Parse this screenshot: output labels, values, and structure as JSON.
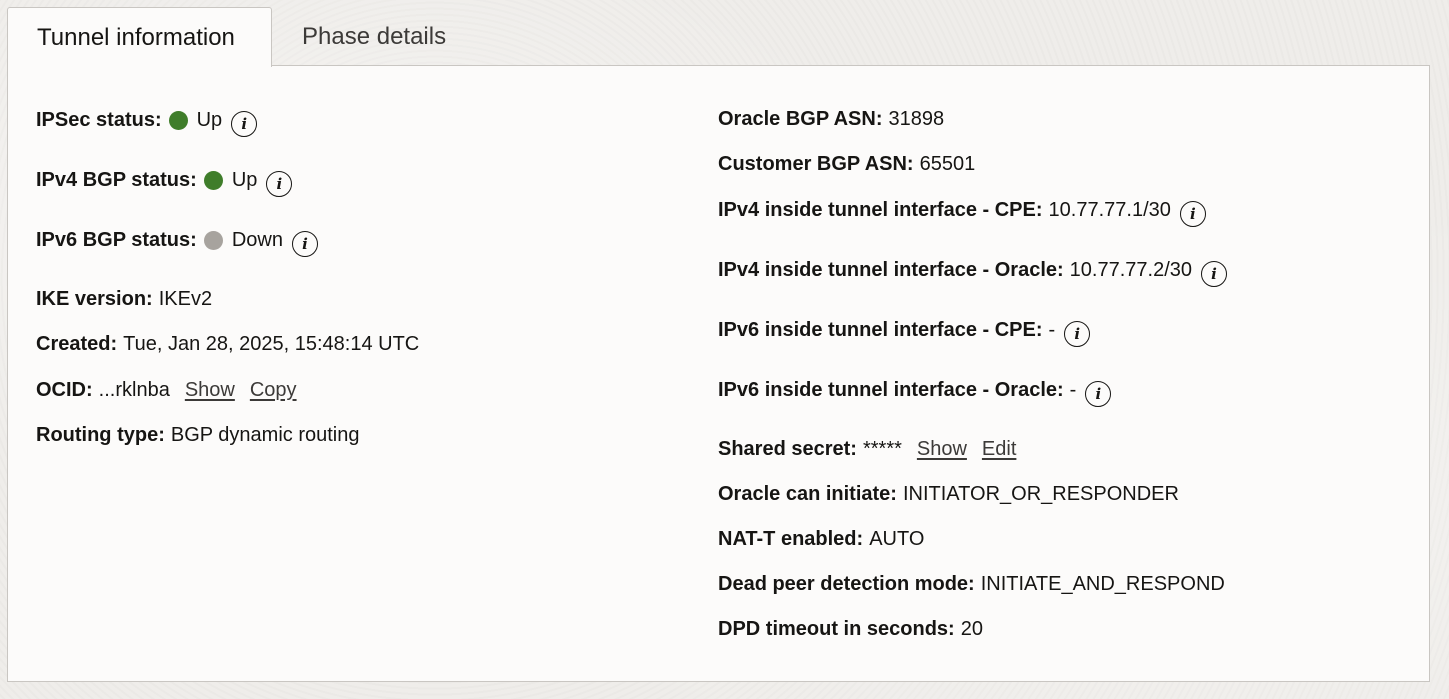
{
  "tabs": {
    "tunnel_information": "Tunnel information",
    "phase_details": "Phase details"
  },
  "colors": {
    "status_up": "#3f7d2a",
    "status_down": "#a7a39e"
  },
  "icons": {
    "info": "i"
  },
  "left": {
    "ipsec_status": {
      "label": "IPSec status:",
      "value": "Up",
      "status": "up",
      "icon": "info-icon"
    },
    "ipv4_bgp_status": {
      "label": "IPv4 BGP status:",
      "value": "Up",
      "status": "up",
      "icon": "info-icon"
    },
    "ipv6_bgp_status": {
      "label": "IPv6 BGP status:",
      "value": "Down",
      "status": "down",
      "icon": "info-icon"
    },
    "ike_version": {
      "label": "IKE version:",
      "value": "IKEv2"
    },
    "created": {
      "label": "Created:",
      "value": "Tue, Jan 28, 2025, 15:48:14 UTC"
    },
    "ocid": {
      "label": "OCID:",
      "value": "...rklnba",
      "show": "Show",
      "copy": "Copy"
    },
    "routing_type": {
      "label": "Routing type:",
      "value": "BGP dynamic routing"
    }
  },
  "right": {
    "oracle_bgp_asn": {
      "label": "Oracle BGP ASN:",
      "value": "31898"
    },
    "customer_bgp_asn": {
      "label": "Customer BGP ASN:",
      "value": "65501"
    },
    "ipv4_cpe": {
      "label": "IPv4 inside tunnel interface - CPE:",
      "value": "10.77.77.1/30",
      "icon": "info-icon"
    },
    "ipv4_oracle": {
      "label": "IPv4 inside tunnel interface - Oracle:",
      "value": "10.77.77.2/30",
      "icon": "info-icon"
    },
    "ipv6_cpe": {
      "label": "IPv6 inside tunnel interface - CPE:",
      "value": "-",
      "icon": "info-icon"
    },
    "ipv6_oracle": {
      "label": "IPv6 inside tunnel interface - Oracle:",
      "value": "-",
      "icon": "info-icon"
    },
    "shared_secret": {
      "label": "Shared secret:",
      "value": "*****",
      "show": "Show",
      "edit": "Edit"
    },
    "oracle_can_initiate": {
      "label": "Oracle can initiate:",
      "value": "INITIATOR_OR_RESPONDER"
    },
    "nat_t_enabled": {
      "label": "NAT-T enabled:",
      "value": "AUTO"
    },
    "dpd_mode": {
      "label": "Dead peer detection mode:",
      "value": "INITIATE_AND_RESPOND"
    },
    "dpd_timeout": {
      "label": "DPD timeout in seconds:",
      "value": "20"
    }
  }
}
